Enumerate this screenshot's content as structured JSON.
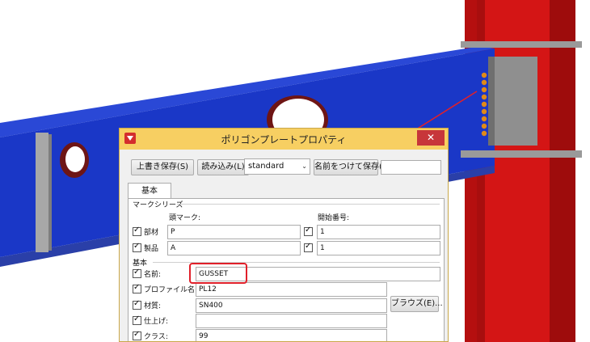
{
  "dialog": {
    "title": "ポリゴンプレートプロパティ",
    "close_glyph": "✕",
    "toolbar": {
      "save_label": "上書き保存(S)",
      "load_label": "読み込み(L)",
      "preset_value": "standard",
      "save_as_label": "名前をつけて保存(N)",
      "save_as_name": ""
    },
    "tab_label": "基本",
    "mark_series": {
      "group_label": "マークシリーズ",
      "prefix_header": "頭マーク:",
      "start_header": "開始番号:",
      "rows": [
        {
          "label": "部材",
          "checked": true,
          "prefix": "P",
          "start_checked": true,
          "start": "1"
        },
        {
          "label": "製品",
          "checked": true,
          "prefix": "A",
          "start_checked": true,
          "start": "1"
        }
      ]
    },
    "basic": {
      "group_label": "基本",
      "fields": [
        {
          "label": "名前:",
          "checked": true,
          "value": "GUSSET"
        },
        {
          "label": "プロファイル名:",
          "checked": true,
          "value": "PL12"
        },
        {
          "label": "材質:",
          "checked": true,
          "value": "SN400"
        },
        {
          "label": "仕上げ:",
          "checked": true,
          "value": ""
        },
        {
          "label": "クラス:",
          "checked": true,
          "value": "99"
        }
      ],
      "browse_label": "ブラウズ(E)..."
    }
  },
  "colors": {
    "beam": "#1a37c7",
    "column": "#d41515",
    "plate": "#8f8f8f",
    "bolt": "#e08a18",
    "titlebar": "#f7cf62",
    "close": "#c7363a",
    "highlight": "#e0202a"
  },
  "icons": [
    "app-icon",
    "chevron-down-icon",
    "checkbox-check-icon",
    "close-icon"
  ]
}
